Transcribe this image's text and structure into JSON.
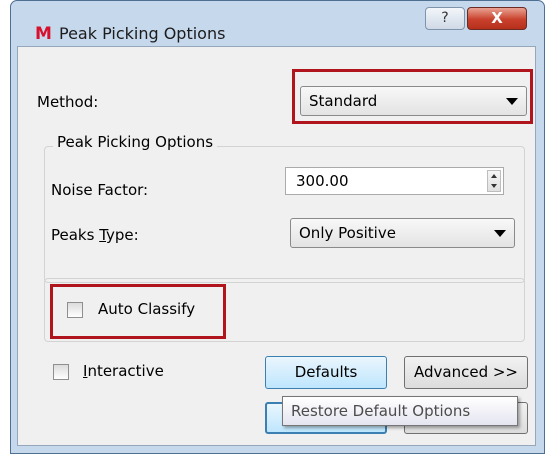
{
  "window": {
    "title": "Peak Picking Options",
    "help_glyph": "?",
    "close_glyph": "X"
  },
  "method": {
    "label": "Method:",
    "value": "Standard"
  },
  "peak_group": {
    "title": "Peak Picking Options",
    "noise_factor_label": "Noise Factor:",
    "noise_factor_value": "300.00",
    "peaks_type_label_prefix": "Peaks ",
    "peaks_type_label_underlined": "T",
    "peaks_type_label_suffix": "ype:",
    "peaks_type_value": "Only Positive"
  },
  "auto_classify": {
    "label": "Auto Classify",
    "checked": false
  },
  "interactive": {
    "label_underlined": "I",
    "label_rest": "nteractive",
    "checked": false
  },
  "buttons": {
    "defaults": "Defaults",
    "advanced": "Advanced >>"
  },
  "tooltip": "Restore Default Options",
  "colors": {
    "highlight_box": "#b0141d",
    "title_bar": "#c6d8ec",
    "close_button": "#c9412c"
  }
}
